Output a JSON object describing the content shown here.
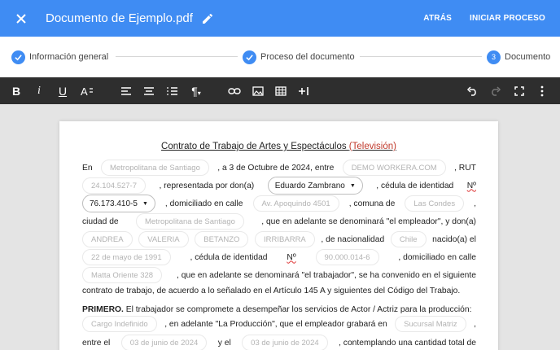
{
  "header": {
    "title": "Documento de Ejemplo.pdf",
    "back_label": "ATRÁS",
    "start_label": "INICIAR PROCESO"
  },
  "stepper": {
    "steps": [
      {
        "label": "Información general",
        "state": "done"
      },
      {
        "label": "Proceso del documento",
        "state": "done"
      },
      {
        "label": "Documento",
        "number": "3",
        "state": "active"
      }
    ]
  },
  "colors": {
    "accent": "#3f8cf3",
    "toolbar": "#2e2e2e"
  },
  "document": {
    "title_main": "Contrato de Trabajo de Artes y Espectáculos ",
    "title_accent": "(Televisión)",
    "l1": {
      "t1": "En",
      "f1": "Metropolitana de Santiago",
      "t2": ", a 3 de Octubre de 2024, entre",
      "f2": "DEMO WORKERA.COM",
      "t3": ", RUT"
    },
    "l2": {
      "f1": "24.104.527-7",
      "t1": ", representada por don(a)",
      "s1": "Eduardo Zambrano",
      "t2": ", cédula de identidad",
      "t3": "Nº"
    },
    "l3": {
      "s1": "76.173.410-5",
      "t1": ", domiciliado en calle",
      "f1": "Av. Apoquindo 4501",
      "t2": ", comuna de",
      "f2": "Las Condes",
      "t3": ","
    },
    "l4": {
      "t1": "ciudad de",
      "f1": "Metropolitana de Santiago",
      "t2": ", que en adelante se denominará \"el empleador\", y don(a)"
    },
    "l5": {
      "f1": "ANDREA",
      "f2": "VALERIA",
      "f3": "BETANZO",
      "f4": "IRRIBARRA",
      "t1": ", de nacionalidad",
      "f5": "Chile",
      "t2": "nacido(a) el"
    },
    "l6": {
      "f1": "22 de mayo de 1991",
      "t1": ", cédula de identidad",
      "t2": "Nº",
      "f2": "90.000.014-6",
      "t3": ", domiciliado en calle"
    },
    "l7": {
      "f1": "Matta Oriente 328",
      "t1": ", que en adelante se denominará \"el trabajador\", se ha convenido en el siguiente"
    },
    "l8": {
      "t1": "contrato de trabajo, de acuerdo a lo señalado en el Artículo 145 A y siguientes del Código del Trabajo."
    },
    "l9": {
      "t1": "PRIMERO.",
      "t2": " El trabajador se compromete a desempeñar los servicios de Actor / Actriz para la producción:"
    },
    "l10": {
      "f1": "Cargo Indefinido",
      "t1": ", en adelante \"La Producción\", que  el empleador grabará en",
      "f2": "Sucursal Matriz",
      "t2": ","
    },
    "l11": {
      "t1": "entre el",
      "f1": "03 de junio de 2024",
      "t2": "y el",
      "f2": "03 de junio de 2024",
      "t3": ", contemplando una cantidad total de"
    }
  }
}
